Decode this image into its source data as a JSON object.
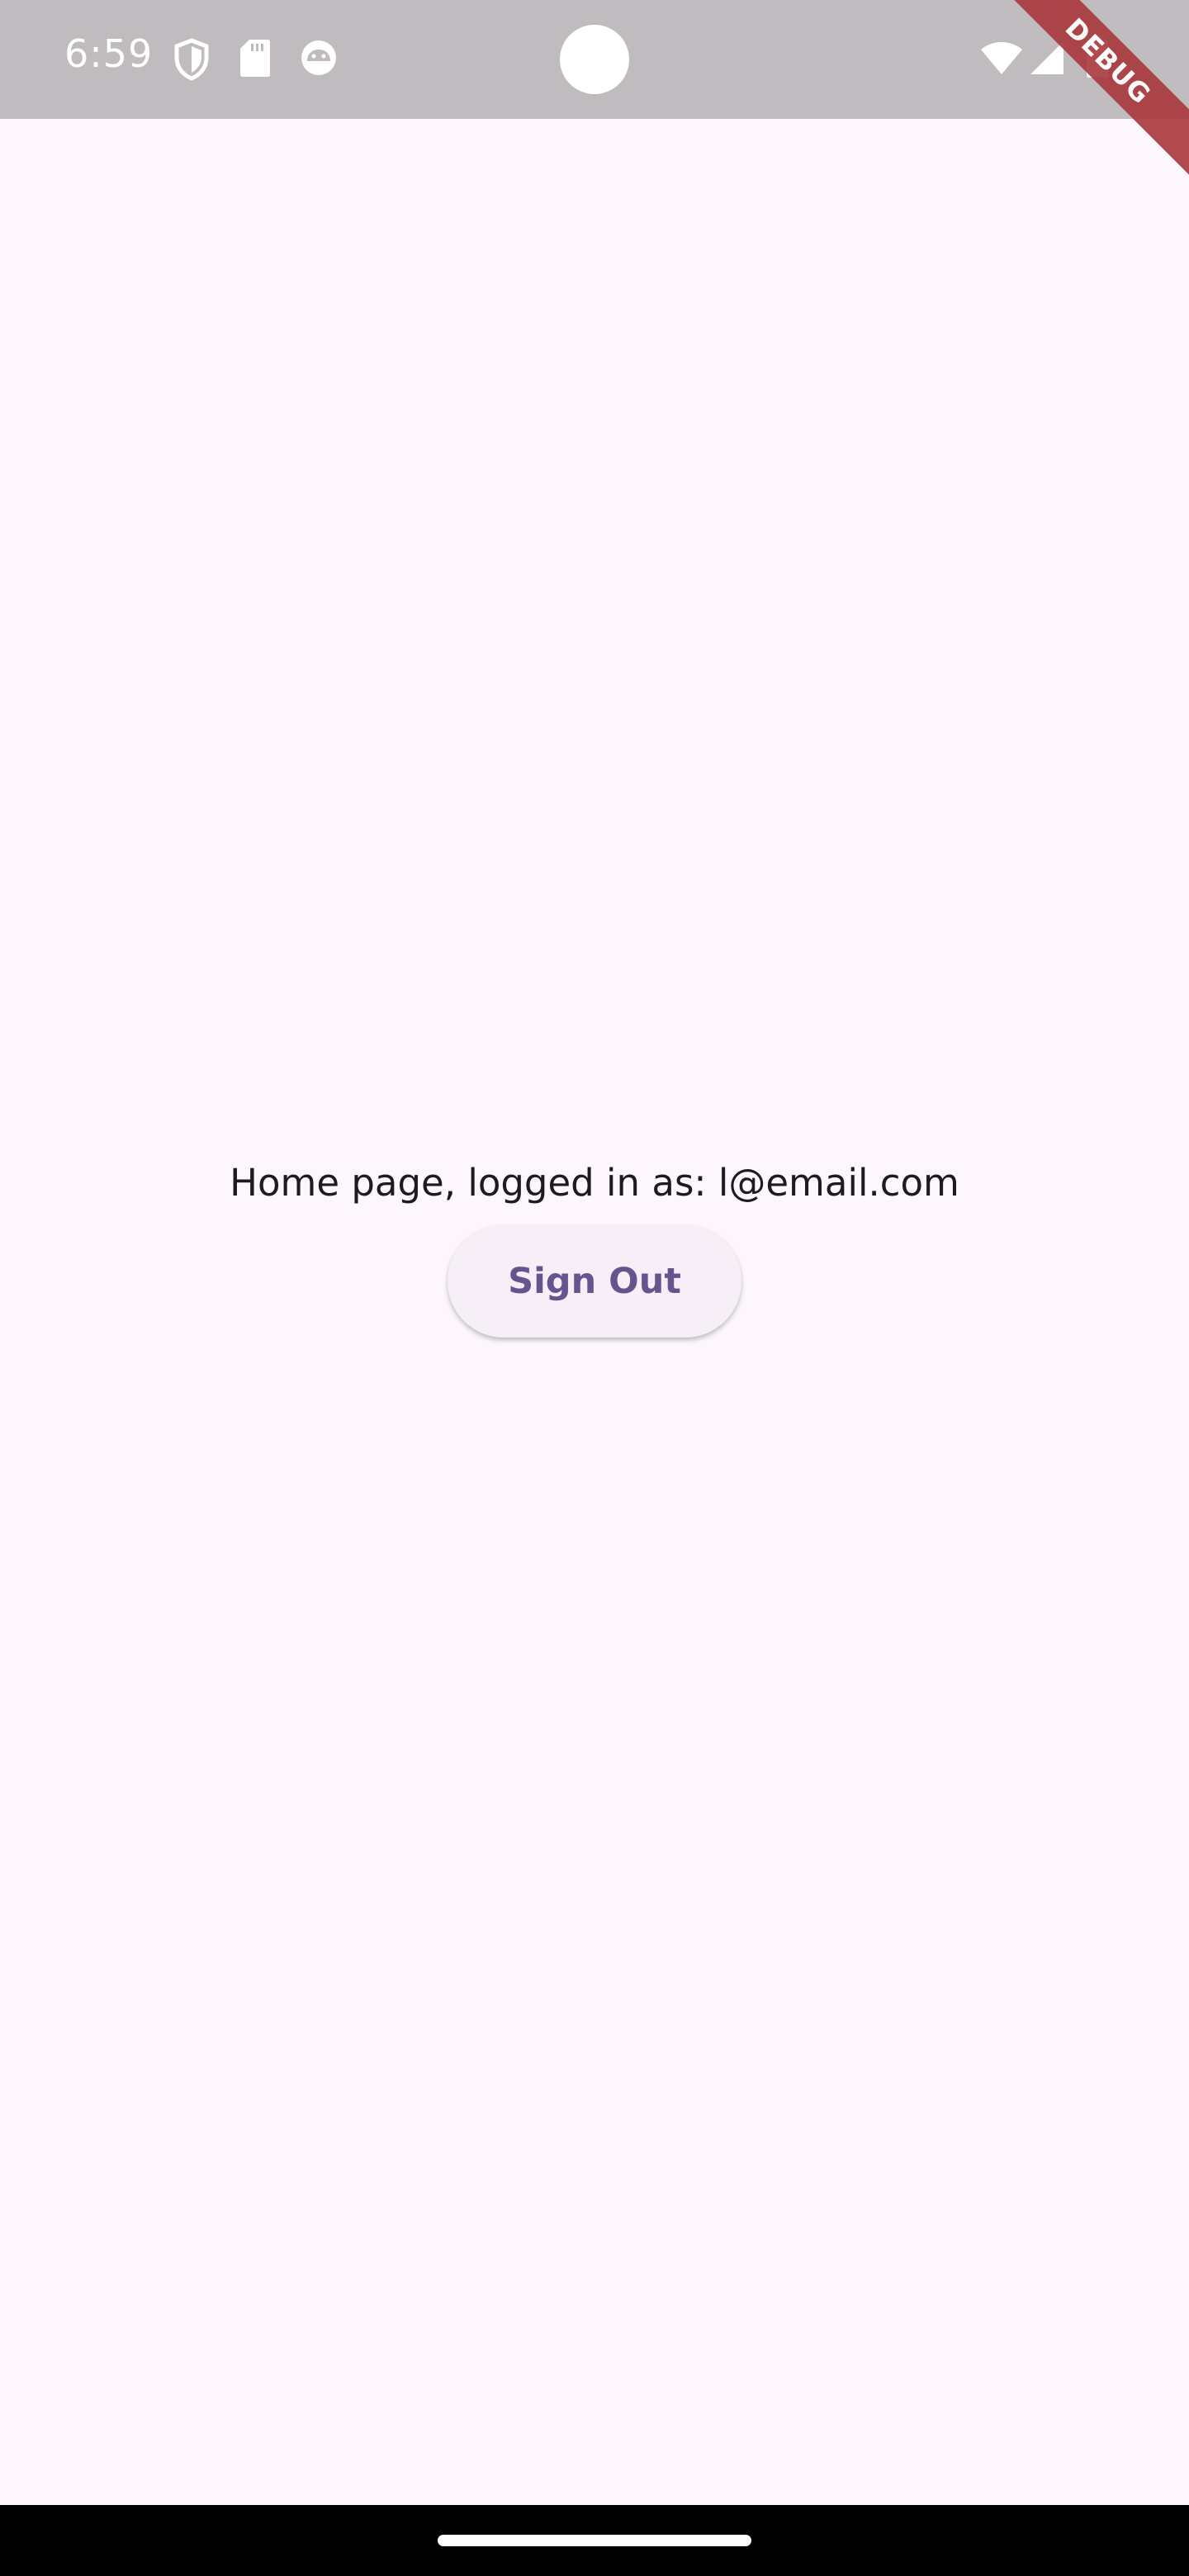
{
  "status_bar": {
    "time": "6:59",
    "icons": [
      "shield-icon",
      "sd-card-icon",
      "android-face-icon",
      "wifi-icon",
      "cellular-signal-icon",
      "battery-icon"
    ],
    "background": "#bfbbbf"
  },
  "debug_banner": {
    "label": "DEBUG",
    "color": "#a8383d"
  },
  "main": {
    "status_text": "Home page, logged in as: l@email.com",
    "sign_out_label": "Sign Out",
    "background": "#fdf7fd",
    "accent": "#65558f"
  }
}
